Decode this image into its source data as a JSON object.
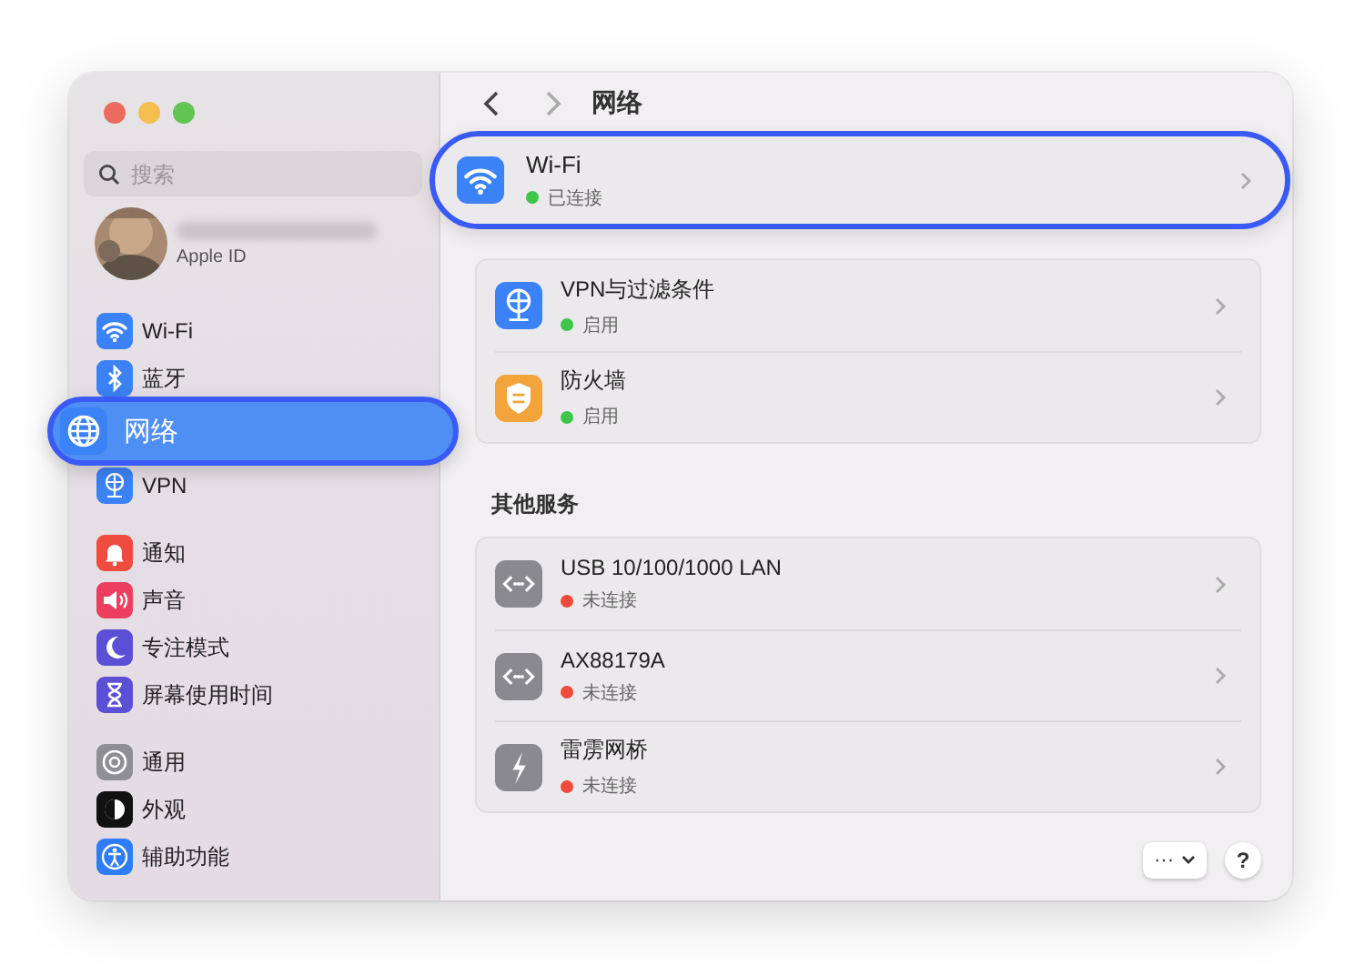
{
  "window": {
    "controls": [
      {
        "kind": "close"
      },
      {
        "kind": "minimize"
      },
      {
        "kind": "zoom"
      }
    ]
  },
  "sidebar": {
    "search": {
      "placeholder": "搜索"
    },
    "account": {
      "subtitle": "Apple ID"
    },
    "sections": [
      {
        "items": [
          {
            "label": "Wi-Fi",
            "selected": false
          },
          {
            "label": "蓝牙",
            "selected": false
          },
          {
            "label": "网络",
            "selected": true
          },
          {
            "label": "VPN",
            "selected": false
          }
        ]
      },
      {
        "items": [
          {
            "label": "通知",
            "selected": false
          },
          {
            "label": "声音",
            "selected": false
          },
          {
            "label": "专注模式",
            "selected": false
          },
          {
            "label": "屏幕使用时间",
            "selected": false
          }
        ]
      },
      {
        "items": [
          {
            "label": "通用",
            "selected": false
          },
          {
            "label": "外观",
            "selected": false
          },
          {
            "label": "辅助功能",
            "selected": false
          }
        ]
      }
    ]
  },
  "main": {
    "title": "网络",
    "groups": [
      {
        "rows": [
          {
            "name": "Wi-Fi",
            "status": "已连接",
            "color": "#3fc64a",
            "selected": true
          }
        ]
      },
      {
        "rows": [
          {
            "name": "VPN与过滤条件",
            "status": "启用",
            "color": "#3fc64a",
            "selected": false
          },
          {
            "name": "防火墙",
            "status": "启用",
            "color": "#3fc64a",
            "selected": false
          }
        ]
      },
      {
        "heading": "其他服务",
        "rows": [
          {
            "name": "USB 10/100/1000 LAN",
            "status": "未连接",
            "color": "#ee4b3a",
            "selected": false
          },
          {
            "name": "AX88179A",
            "status": "未连接",
            "color": "#ee4b3a",
            "selected": false
          },
          {
            "name": "雷雳网桥",
            "status": "未连接",
            "color": "#ee4b3a",
            "selected": false
          }
        ]
      }
    ],
    "footer": {
      "more": "···",
      "help": "?"
    }
  }
}
